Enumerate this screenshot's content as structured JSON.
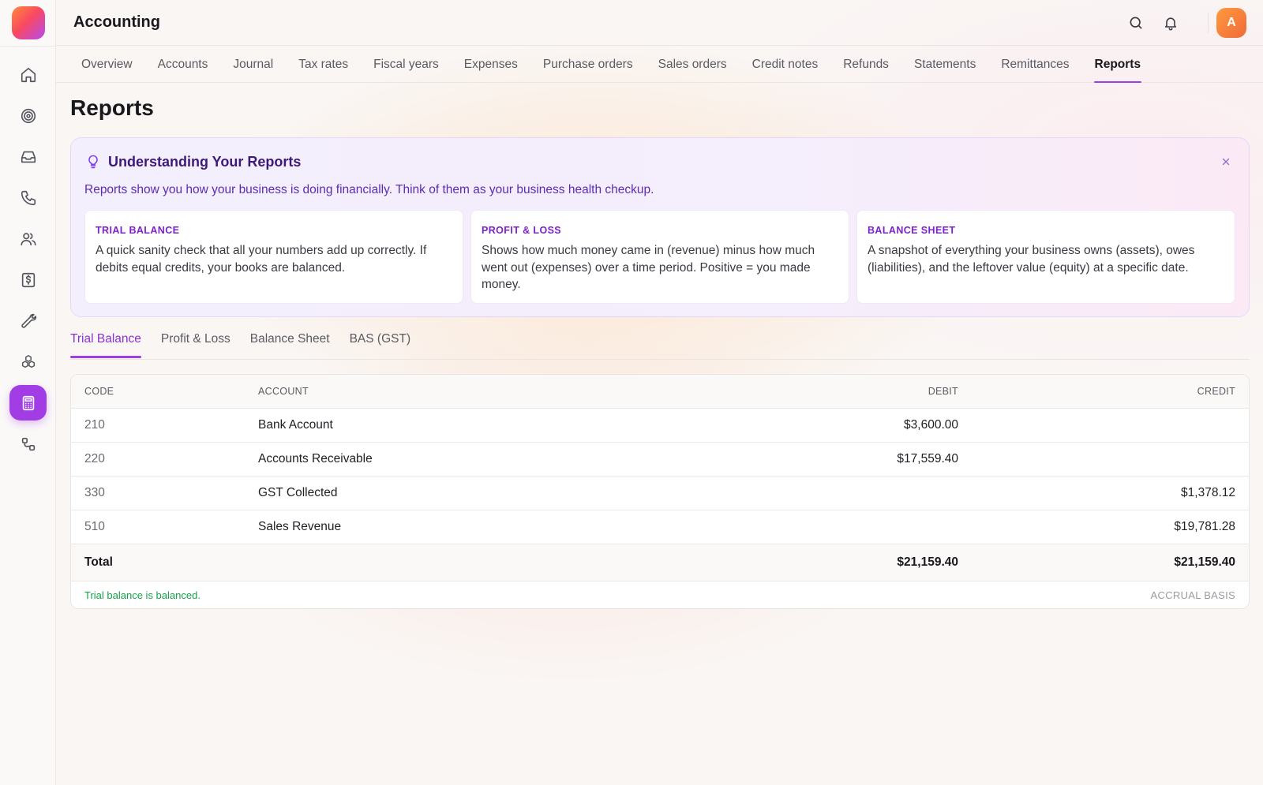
{
  "app": {
    "title": "Accounting",
    "avatar_initial": "A"
  },
  "colors": {
    "accent": "#a23de6",
    "success": "#16a34a",
    "info_title": "#3e1a78"
  },
  "sidebar": {
    "items": [
      {
        "icon": "home-icon",
        "active": false
      },
      {
        "icon": "target-icon",
        "active": false
      },
      {
        "icon": "inbox-icon",
        "active": false
      },
      {
        "icon": "phone-icon",
        "active": false
      },
      {
        "icon": "users-icon",
        "active": false
      },
      {
        "icon": "dollar-receipt-icon",
        "active": false
      },
      {
        "icon": "wrench-icon",
        "active": false
      },
      {
        "icon": "cubes-icon",
        "active": false
      },
      {
        "icon": "calculator-icon",
        "active": true
      },
      {
        "icon": "workflow-icon",
        "active": false
      }
    ]
  },
  "topbar": {
    "icons": [
      "search-icon",
      "bell-icon"
    ]
  },
  "subnav": {
    "tabs": [
      {
        "label": "Overview",
        "active": false
      },
      {
        "label": "Accounts",
        "active": false
      },
      {
        "label": "Journal",
        "active": false
      },
      {
        "label": "Tax rates",
        "active": false
      },
      {
        "label": "Fiscal years",
        "active": false
      },
      {
        "label": "Expenses",
        "active": false
      },
      {
        "label": "Purchase orders",
        "active": false
      },
      {
        "label": "Sales orders",
        "active": false
      },
      {
        "label": "Credit notes",
        "active": false
      },
      {
        "label": "Refunds",
        "active": false
      },
      {
        "label": "Statements",
        "active": false
      },
      {
        "label": "Remittances",
        "active": false
      },
      {
        "label": "Reports",
        "active": true
      }
    ]
  },
  "page": {
    "title": "Reports"
  },
  "info": {
    "title": "Understanding Your Reports",
    "subtitle": "Reports show you how your business is doing financially. Think of them as your business health checkup.",
    "boxes": [
      {
        "title": "TRIAL BALANCE",
        "text": "A quick sanity check that all your numbers add up correctly. If debits equal credits, your books are balanced."
      },
      {
        "title": "PROFIT & LOSS",
        "text": "Shows how much money came in (revenue) minus how much went out (expenses) over a time period. Positive = you made money."
      },
      {
        "title": "BALANCE SHEET",
        "text": "A snapshot of everything your business owns (assets), owes (liabilities), and the leftover value (equity) at a specific date."
      }
    ]
  },
  "report_tabs": [
    {
      "label": "Trial Balance",
      "active": true
    },
    {
      "label": "Profit & Loss",
      "active": false
    },
    {
      "label": "Balance Sheet",
      "active": false
    },
    {
      "label": "BAS (GST)",
      "active": false
    }
  ],
  "table": {
    "headers": {
      "code": "CODE",
      "account": "ACCOUNT",
      "debit": "DEBIT",
      "credit": "CREDIT"
    },
    "rows": [
      {
        "code": "210",
        "account": "Bank Account",
        "debit": "$3,600.00",
        "credit": ""
      },
      {
        "code": "220",
        "account": "Accounts Receivable",
        "debit": "$17,559.40",
        "credit": ""
      },
      {
        "code": "330",
        "account": "GST Collected",
        "debit": "",
        "credit": "$1,378.12"
      },
      {
        "code": "510",
        "account": "Sales Revenue",
        "debit": "",
        "credit": "$19,781.28"
      }
    ],
    "total": {
      "label": "Total",
      "debit": "$21,159.40",
      "credit": "$21,159.40"
    },
    "status": "Trial balance is balanced.",
    "basis": "ACCRUAL BASIS"
  }
}
